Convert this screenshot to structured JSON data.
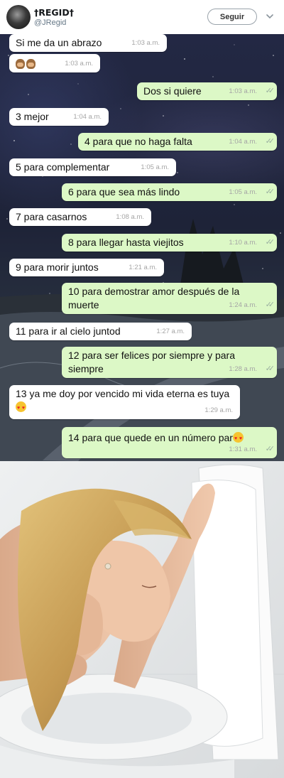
{
  "tweet": {
    "display_name": "†REGID†",
    "handle": "@JRegid",
    "follow_label": "Seguir"
  },
  "chat": {
    "messages": [
      {
        "dir": "in",
        "text": "Si me da un abrazo",
        "time": "1:03 a.m."
      },
      {
        "dir": "in",
        "text": "",
        "emoji": "see-no-evil-monkeys",
        "time": "1:03 a.m."
      },
      {
        "dir": "out",
        "text": "Dos si quiere",
        "time": "1:03 a.m."
      },
      {
        "dir": "in",
        "text": "3 mejor",
        "time": "1:04 a.m."
      },
      {
        "dir": "out",
        "text": "4 para que no haga falta",
        "time": "1:04 a.m."
      },
      {
        "dir": "in",
        "text": "5 para complementar",
        "time": "1:05 a.m."
      },
      {
        "dir": "out",
        "text": "6 para que sea más lindo",
        "time": "1:05 a.m."
      },
      {
        "dir": "in",
        "text": "7 para casarnos",
        "time": "1:08 a.m."
      },
      {
        "dir": "out",
        "text": "8 para llegar hasta viejitos",
        "time": "1:10 a.m."
      },
      {
        "dir": "in",
        "text": "9 para morir juntos",
        "time": "1:21 a.m."
      },
      {
        "dir": "out",
        "text": "10 para demostrar amor después de la muerte",
        "time": "1:24 a.m."
      },
      {
        "dir": "in",
        "text": "11 para ir al cielo juntod",
        "time": "1:27 a.m."
      },
      {
        "dir": "out",
        "text": "12 para ser felices por siempre y para siempre",
        "time": "1:28 a.m."
      },
      {
        "dir": "in",
        "text": "13 ya me doy por vencido mi vida eterna es tuya",
        "emoji": "heart-eyes",
        "time": "1:29 a.m."
      },
      {
        "dir": "out",
        "text": "14 para que quede en un número par",
        "emoji": "heart-eyes",
        "time": "1:31 a.m."
      }
    ]
  },
  "icons": {
    "more": "chevron-down-icon",
    "read_receipt": "double-check-icon"
  },
  "colors": {
    "outgoing_bubble": "#dcf8c6",
    "incoming_bubble": "#ffffff",
    "timestamp": "#a5a5a5"
  }
}
